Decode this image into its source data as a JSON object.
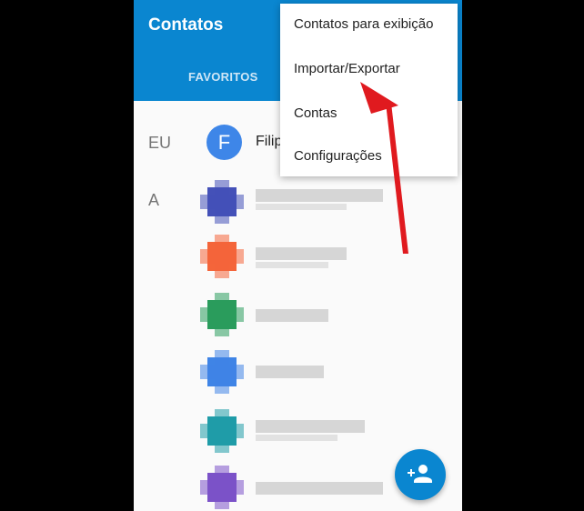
{
  "appbar": {
    "title": "Contatos",
    "tab_favorites": "FAVORITOS"
  },
  "contacts": {
    "section_me": "EU",
    "me_initial": "F",
    "me_name_partial": "Filip",
    "section_a": "A",
    "blurred_rows": [
      {
        "color": "#4451b8"
      },
      {
        "color": "#f4653a"
      },
      {
        "color": "#2a9c5c"
      },
      {
        "color": "#3f84e6"
      },
      {
        "color": "#1f9ca8"
      },
      {
        "color": "#7b52c8"
      }
    ]
  },
  "menu": {
    "items": [
      {
        "label": "Contatos para exibição"
      },
      {
        "label": "Importar/Exportar"
      },
      {
        "label": "Contas"
      },
      {
        "label": "Configurações"
      }
    ]
  },
  "fab": {
    "icon": "add-person-icon"
  },
  "colors": {
    "accent": "#0a86d0",
    "arrow": "#e01a1f"
  }
}
